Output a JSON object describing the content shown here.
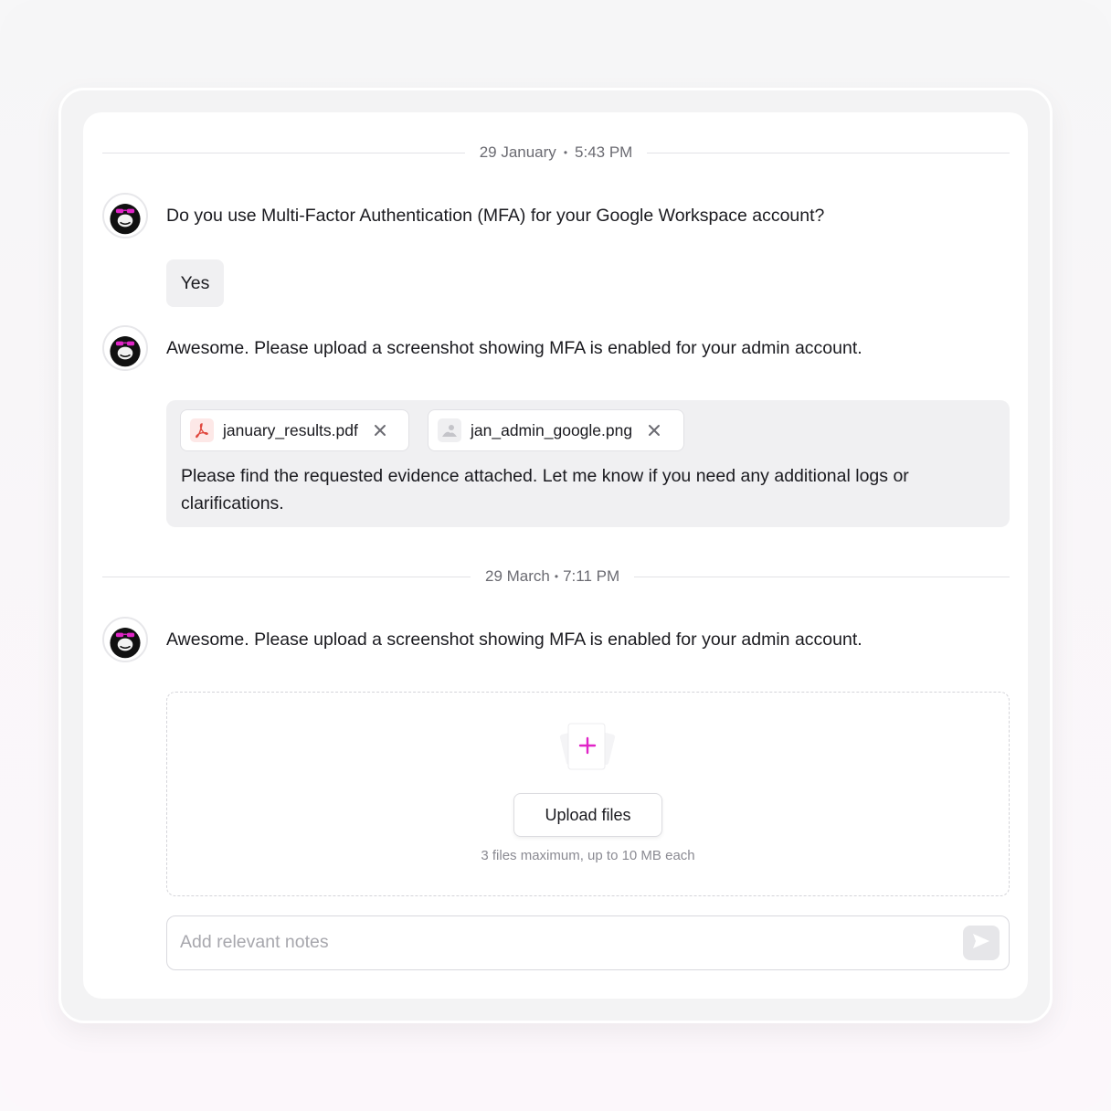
{
  "thread": {
    "divider_1": {
      "date": "29 January",
      "separator": "•",
      "time": "5:43 PM"
    },
    "divider_2": {
      "date": "29 March",
      "separator": "•",
      "time": "7:11 PM"
    },
    "question_1": "Do you use Multi-Factor Authentication (MFA) for your Google Workspace account?",
    "answer_1": "Yes",
    "question_2": "Awesome. Please upload a screenshot showing MFA is enabled for your admin account.",
    "question_3": "Awesome. Please upload a screenshot showing MFA is enabled for your admin account.",
    "avatar_icon": "gorilla-with-pink-glasses-icon"
  },
  "evidence": {
    "files": [
      {
        "name": "january_results.pdf",
        "icon": "pdf-icon",
        "remove_icon": "close-icon"
      },
      {
        "name": "jan_admin_google.png",
        "icon": "image-icon",
        "remove_icon": "close-icon"
      }
    ],
    "note": "Please find the requested evidence attached. Let me know if you need any additional logs or clarifications."
  },
  "upload": {
    "icon": "add-file-icon",
    "button_label": "Upload files",
    "hint": "3 files maximum, up to 10 MB each"
  },
  "notes": {
    "placeholder": "Add relevant notes",
    "value": "",
    "send_icon": "send-icon"
  },
  "colors": {
    "accent": "#e024c7",
    "pdf_red": "#e0483e",
    "panel_bg": "#ffffff",
    "bubble_bg": "#f0f0f2"
  }
}
